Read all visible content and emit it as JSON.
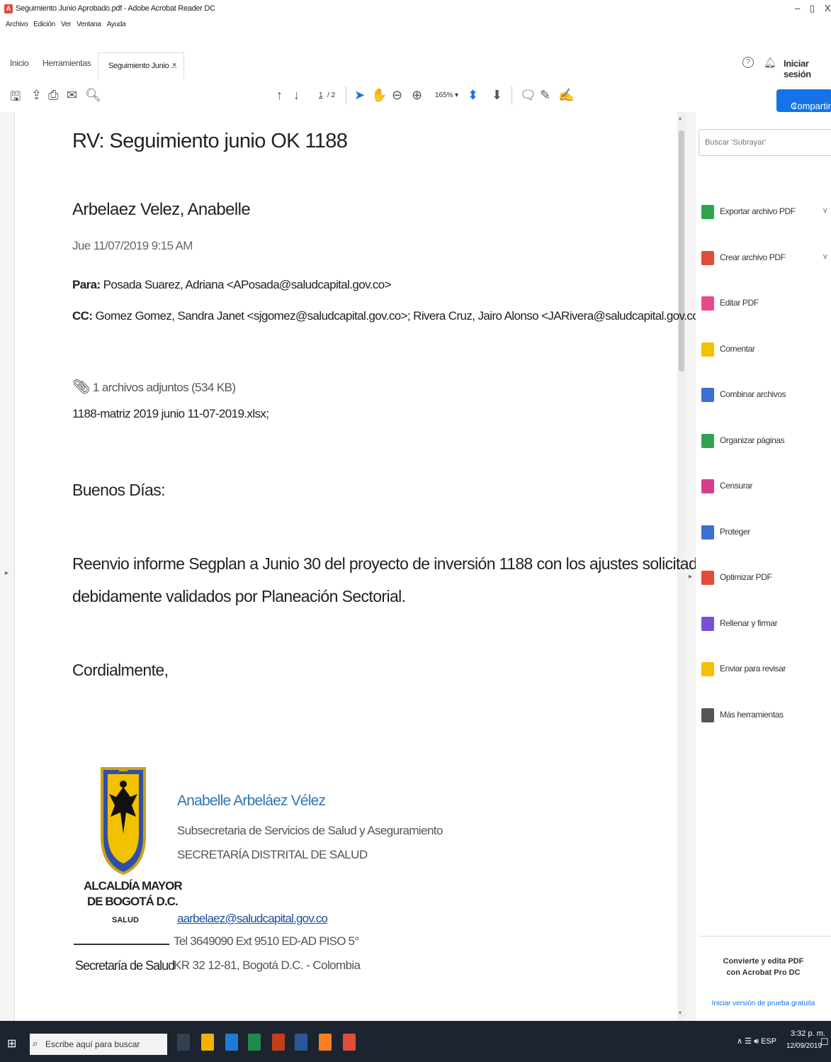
{
  "window": {
    "title": "Seguimiento Junio Aprobado.pdf - Adobe Acrobat Reader DC",
    "minimize": "–",
    "maximize": "▯",
    "close": "X"
  },
  "menu": [
    "Archivo",
    "Edición",
    "Ver",
    "Ventana",
    "Ayuda"
  ],
  "tabs": {
    "home": "Inicio",
    "tools": "Herramientas",
    "document": "Seguimiento Junio ...",
    "close": "×",
    "signin": "Iniciar sesión"
  },
  "toolbar": {
    "page_current": "1",
    "page_total": "/ 2",
    "zoom": "165%",
    "share_label": "Compartir"
  },
  "email": {
    "subject": "RV: Seguimiento junio OK 1188",
    "sender": "Arbelaez Velez, Anabelle",
    "date": "Jue 11/07/2019 9:15 AM",
    "to_label": "Para:",
    "to": "Posada Suarez, Adriana <APosada@saludcapital.gov.co>",
    "cc_label": "CC:",
    "cc": "Gomez Gomez, Sandra Janet <sjgomez@saludcapital.gov.co>; Rivera Cruz, Jairo Alonso <JARivera@saludcapital.gov.co>",
    "attachments": "1 archivos adjuntos (534 KB)",
    "attachment_file": "1188-matriz 2019 junio 11-07-2019.xlsx;",
    "greeting": "Buenos Días:",
    "body_line1": "Reenvio informe Segplan a Junio 30 del proyecto de inversión 1188 con los ajustes solicitados y",
    "body_line2": "debidamente validados por Planeación Sectorial.",
    "closing": "Cordialmente,"
  },
  "signature": {
    "logo_line1": "ALCALDÍA MAYOR",
    "logo_line2": "DE BOGOTÁ D.C.",
    "logo_line3": "SALUD",
    "logo_line4": "Secretaría de Salud",
    "name": "Anabelle Arbeláez Vélez",
    "title": "Subsecretaria de Servicios de Salud y Aseguramiento",
    "org": "SECRETARÍA DISTRITAL DE SALUD",
    "email": "aarbelaez@saludcapital.gov.co",
    "tel": "Tel 3649090 Ext 9510 ED-AD PISO 5°",
    "address": "KR 32 12-81, Bogotá D.C. - Colombia"
  },
  "right_panel": {
    "search_placeholder": "Buscar 'Subrayar'",
    "tools": [
      {
        "label": "Exportar archivo PDF",
        "color": "#2ea44f",
        "chevron": "v"
      },
      {
        "label": "Crear archivo PDF",
        "color": "#e34b3a",
        "chevron": "v"
      },
      {
        "label": "Editar PDF",
        "color": "#e84a8a"
      },
      {
        "label": "Comentar",
        "color": "#f2c200"
      },
      {
        "label": "Combinar archivos",
        "color": "#3b6fd6"
      },
      {
        "label": "Organizar páginas",
        "color": "#2ea44f"
      },
      {
        "label": "Censurar",
        "color": "#d63c8a"
      },
      {
        "label": "Proteger",
        "color": "#3b6fd6"
      },
      {
        "label": "Optimizar PDF",
        "color": "#e34b3a"
      },
      {
        "label": "Rellenar y firmar",
        "color": "#7b4fd6"
      },
      {
        "label": "Enviar para revisar",
        "color": "#f2c200"
      },
      {
        "label": "Más herramientas",
        "color": "#555555"
      }
    ],
    "promo_line1": "Convierte y edita PDF",
    "promo_line2": "con Acrobat Pro DC",
    "promo_link": "Iniciar versión de prueba gratuita"
  },
  "taskbar": {
    "search_placeholder": "Escribe aquí para buscar",
    "lang": "ESP",
    "time": "3:32 p. m.",
    "date": "12/09/2019"
  }
}
